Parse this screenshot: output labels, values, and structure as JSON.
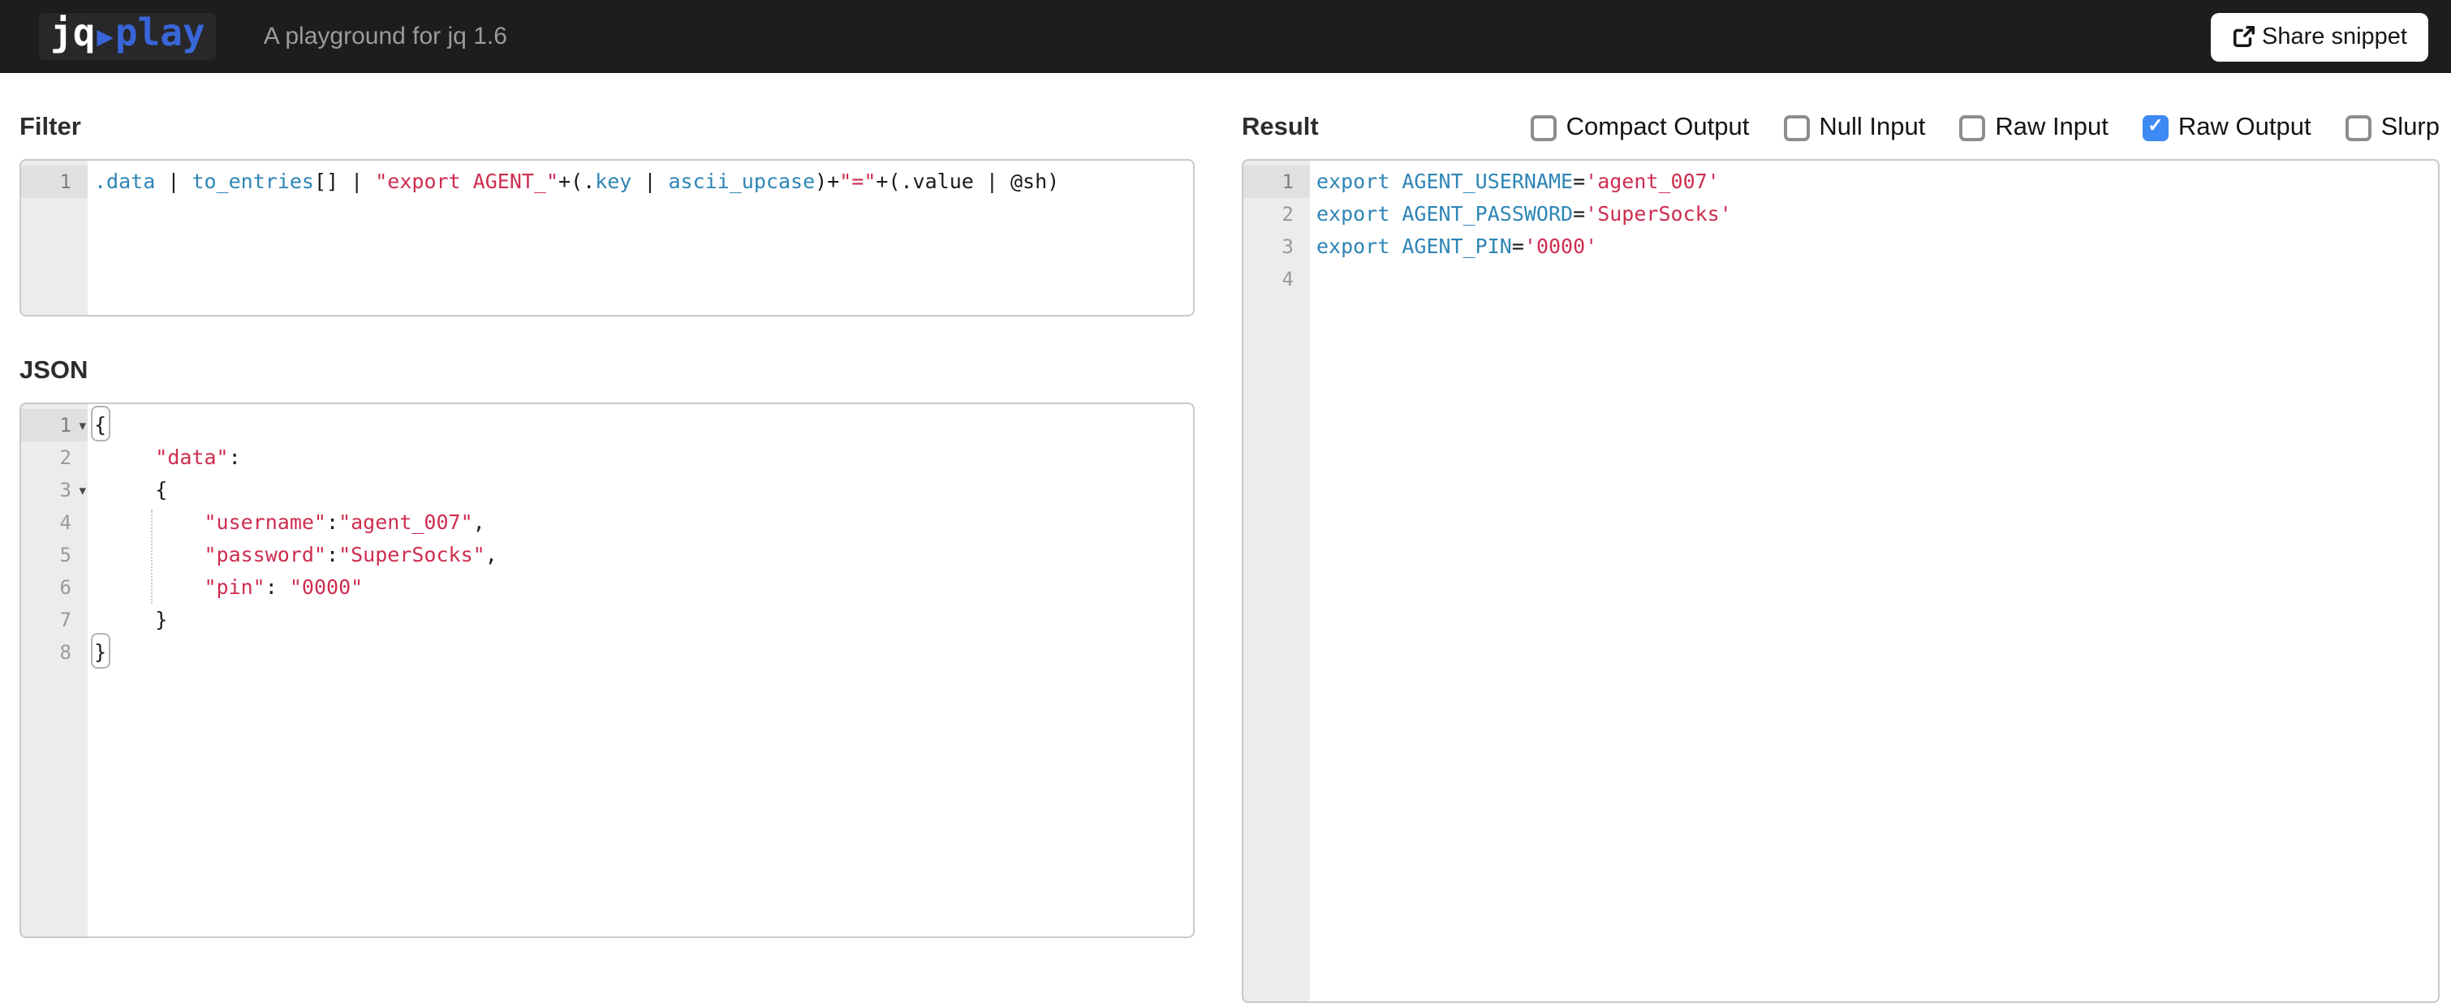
{
  "navbar": {
    "logo_jq": "jq",
    "logo_play": "play",
    "tagline": "A playground for jq 1.6",
    "share_button": "Share snippet"
  },
  "colors": {
    "code_blue": "#2E85B6",
    "code_red": "#CE2D4F",
    "checkbox_blue": "#3D8AF5",
    "logo_blue": "#3866D9"
  },
  "panels": {
    "filter": {
      "heading": "Filter",
      "editor": {
        "lines": [
          {
            "n": "1",
            "active": true,
            "tokens": [
              [
                "b",
                ".data"
              ],
              [
                "p",
                " | "
              ],
              [
                "b",
                "to_entries"
              ],
              [
                "p",
                "[] | "
              ],
              [
                "s",
                "\"export AGENT_\""
              ],
              [
                "p",
                "+(."
              ],
              [
                "b",
                "key"
              ],
              [
                "p",
                " | "
              ],
              [
                "b",
                "ascii_upcase"
              ],
              [
                "p",
                ")+"
              ],
              [
                "s",
                "\"=\""
              ],
              [
                "p",
                "+(.value | @sh)"
              ]
            ]
          }
        ]
      }
    },
    "json": {
      "heading": "JSON",
      "editor": {
        "lines": [
          {
            "n": "1",
            "active": true,
            "fold": true,
            "tokens": [
              [
                "x",
                "{"
              ]
            ]
          },
          {
            "n": "2",
            "tokens": [
              [
                "p",
                "     "
              ],
              [
                "s",
                "\"data\""
              ],
              [
                "p",
                ":"
              ]
            ]
          },
          {
            "n": "3",
            "fold": true,
            "tokens": [
              [
                "p",
                "     {"
              ]
            ]
          },
          {
            "n": "4",
            "tokens": [
              [
                "p",
                "         "
              ],
              [
                "s",
                "\"username\""
              ],
              [
                "p",
                ":"
              ],
              [
                "s",
                "\"agent_007\""
              ],
              [
                "p",
                ","
              ]
            ]
          },
          {
            "n": "5",
            "tokens": [
              [
                "p",
                "         "
              ],
              [
                "s",
                "\"password\""
              ],
              [
                "p",
                ":"
              ],
              [
                "s",
                "\"SuperSocks\""
              ],
              [
                "p",
                ","
              ]
            ]
          },
          {
            "n": "6",
            "tokens": [
              [
                "p",
                "         "
              ],
              [
                "s",
                "\"pin\""
              ],
              [
                "p",
                ": "
              ],
              [
                "s",
                "\"0000\""
              ]
            ]
          },
          {
            "n": "7",
            "tokens": [
              [
                "p",
                "     }"
              ]
            ]
          },
          {
            "n": "8",
            "tokens": [
              [
                "x",
                "}"
              ]
            ]
          }
        ]
      }
    },
    "result": {
      "heading": "Result",
      "options": [
        {
          "label": "Compact Output",
          "checked": false
        },
        {
          "label": "Null Input",
          "checked": false
        },
        {
          "label": "Raw Input",
          "checked": false
        },
        {
          "label": "Raw Output",
          "checked": true
        },
        {
          "label": "Slurp",
          "checked": false
        }
      ],
      "check_glyph": "✓",
      "editor": {
        "lines": [
          {
            "n": "1",
            "active": true,
            "tokens": [
              [
                "b",
                "export AGENT_USERNAME"
              ],
              [
                "p",
                "="
              ],
              [
                "s",
                "'agent_007'"
              ]
            ]
          },
          {
            "n": "2",
            "tokens": [
              [
                "b",
                "export AGENT_PASSWORD"
              ],
              [
                "p",
                "="
              ],
              [
                "s",
                "'SuperSocks'"
              ]
            ]
          },
          {
            "n": "3",
            "tokens": [
              [
                "b",
                "export AGENT_PIN"
              ],
              [
                "p",
                "="
              ],
              [
                "s",
                "'0000'"
              ]
            ]
          },
          {
            "n": "4",
            "tokens": []
          }
        ]
      }
    }
  }
}
